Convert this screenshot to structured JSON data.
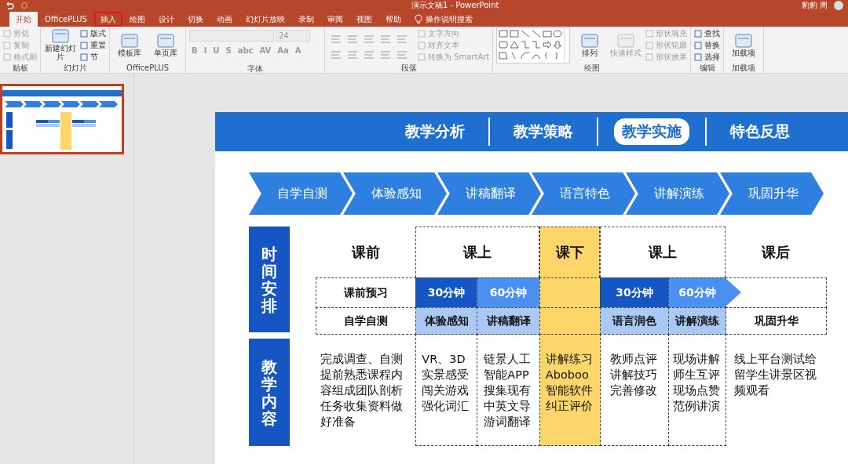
{
  "title_bar": {
    "title": "演示文稿1  -  PowerPoint",
    "user": "豹豹 周"
  },
  "tabs": [
    {
      "label": "开始",
      "selected": true,
      "highlighted": false
    },
    {
      "label": "OfficePLUS",
      "selected": false,
      "highlighted": false
    },
    {
      "label": "插入",
      "selected": false,
      "highlighted": true
    },
    {
      "label": "绘图",
      "selected": false,
      "highlighted": false
    },
    {
      "label": "设计",
      "selected": false,
      "highlighted": false
    },
    {
      "label": "切换",
      "selected": false,
      "highlighted": false
    },
    {
      "label": "动画",
      "selected": false,
      "highlighted": false
    },
    {
      "label": "幻灯片放映",
      "selected": false,
      "highlighted": false
    },
    {
      "label": "录制",
      "selected": false,
      "highlighted": false
    },
    {
      "label": "审阅",
      "selected": false,
      "highlighted": false
    },
    {
      "label": "视图",
      "selected": false,
      "highlighted": false
    },
    {
      "label": "帮助",
      "selected": false,
      "highlighted": false
    }
  ],
  "tell_me": {
    "placeholder": "操作说明搜索"
  },
  "ribbon_groups": [
    {
      "kind": "stack",
      "label": "贴板",
      "items": [
        {
          "kind": "small",
          "label": "剪切",
          "disabled": true
        },
        {
          "kind": "small",
          "label": "复制",
          "disabled": true
        },
        {
          "kind": "small",
          "label": "格式刷",
          "disabled": true
        }
      ]
    },
    {
      "kind": "stack",
      "label": "幻灯片",
      "items": [
        {
          "kind": "large",
          "label": "新建幻灯片",
          "disabled": false
        },
        {
          "kind": "small",
          "label": "版式",
          "disabled": false
        },
        {
          "kind": "small",
          "label": "重置",
          "disabled": false
        },
        {
          "kind": "small",
          "label": "节",
          "disabled": false
        }
      ]
    },
    {
      "kind": "stack",
      "label": "OfficePLUS",
      "items": [
        {
          "kind": "large",
          "label": "模板库",
          "disabled": false
        },
        {
          "kind": "large",
          "label": "单页库",
          "disabled": false
        }
      ]
    },
    {
      "kind": "rows",
      "label": "字体",
      "items": [
        {
          "kind": "field",
          "disabled": true
        },
        {
          "kind": "field",
          "value": "24",
          "disabled": true
        },
        {
          "kind": "glyph",
          "label": "B",
          "disabled": true
        },
        {
          "kind": "glyph",
          "label": "I",
          "disabled": true
        },
        {
          "kind": "glyph",
          "label": "U",
          "disabled": true
        },
        {
          "kind": "glyph",
          "label": "S",
          "disabled": true
        },
        {
          "kind": "glyph",
          "label": "abc",
          "disabled": true
        },
        {
          "kind": "glyph",
          "label": "AV",
          "disabled": true
        },
        {
          "kind": "glyph",
          "label": "Aa",
          "disabled": true
        },
        {
          "kind": "glyph",
          "label": "A",
          "disabled": true
        }
      ]
    },
    {
      "kind": "paragraph",
      "label": "段落",
      "items": [
        {
          "kind": "small",
          "label": "文字方向",
          "disabled": true
        },
        {
          "kind": "small",
          "label": "对齐文本",
          "disabled": true
        },
        {
          "kind": "small",
          "label": "转换为 SmartArt",
          "disabled": true
        }
      ]
    },
    {
      "kind": "shapes",
      "label": "绘图",
      "items": [
        {
          "kind": "large",
          "label": "排列",
          "disabled": false
        },
        {
          "kind": "large",
          "label": "快速样式",
          "disabled": true
        },
        {
          "kind": "small",
          "label": "形状填充",
          "disabled": true
        },
        {
          "kind": "small",
          "label": "形状轮廓",
          "disabled": true
        },
        {
          "kind": "small",
          "label": "形状效果",
          "disabled": true
        }
      ]
    },
    {
      "kind": "stack",
      "label": "编辑",
      "items": [
        {
          "kind": "small",
          "label": "查找",
          "disabled": false
        },
        {
          "kind": "small",
          "label": "替换",
          "disabled": false
        },
        {
          "kind": "small",
          "label": "选择",
          "disabled": false
        }
      ]
    },
    {
      "kind": "stack",
      "label": "加载项",
      "items": [
        {
          "kind": "large",
          "label": "加载项",
          "disabled": false
        }
      ]
    }
  ],
  "thumbnails": [
    {
      "selected": true
    }
  ],
  "slide": {
    "nav": [
      {
        "label": "教学分析",
        "selected": false
      },
      {
        "label": "教学策略",
        "selected": false
      },
      {
        "label": "教学实施",
        "selected": true
      },
      {
        "label": "特色反思",
        "selected": false
      }
    ],
    "steps": [
      "自学自测",
      "体验感知",
      "讲稿翻译",
      "语言特色",
      "讲解演练",
      "巩固升华"
    ],
    "side_labels": [
      "时间安排",
      "教学内容"
    ],
    "phases": [
      {
        "heading": "课前",
        "highlighted": false,
        "columns": [
          {
            "cells": [
              {
                "text": "课前预习"
              },
              {
                "text": "自学自测"
              }
            ],
            "content": "完成调查、自测提前熟悉课程内容组成团队剖析任务收集资料做好准备"
          }
        ]
      },
      {
        "heading": "课上",
        "highlighted": false,
        "columns": [
          {
            "cells": [
              {
                "text": "30分钟",
                "color": "#1656c4"
              },
              {
                "text": "体验感知",
                "color": "#a9c8f4"
              }
            ],
            "content": "VR、3D实景感受闯关游戏强化词汇"
          },
          {
            "cells": [
              {
                "text": "60分钟",
                "color": "#4b8ff0"
              },
              {
                "text": "讲稿翻译",
                "color": "#a9c8f4"
              }
            ],
            "content": "链景人工智能APP搜集现有中英文导游词翻译"
          }
        ]
      },
      {
        "heading": "课下",
        "highlighted": true,
        "columns": [
          {
            "cells": [
              {
                "color": "#fdd66a"
              },
              {
                "color": "#fdd66a"
              }
            ],
            "content": "讲解练习Aboboo智能软件纠正评价"
          }
        ]
      },
      {
        "heading": "课上",
        "highlighted": false,
        "columns": [
          {
            "cells": [
              {
                "text": "30分钟",
                "color": "#1656c4"
              },
              {
                "text": "语言润色",
                "color": "#a9c8f4"
              }
            ],
            "content": "教师点评讲解技巧完善修改"
          },
          {
            "cells": [
              {
                "text": "60分钟",
                "color": "#4b8ff0",
                "arrow": true
              },
              {
                "text": "讲解演练",
                "color": "#a9c8f4"
              }
            ],
            "content": "现场讲解师生互评现场点赞范例讲演"
          }
        ]
      },
      {
        "heading": "课后",
        "highlighted": false,
        "columns": [
          {
            "cells": [
              {},
              {
                "text": "巩固升华"
              }
            ],
            "content": "线上平台测试给留学生讲景区视频观看"
          }
        ]
      }
    ]
  }
}
